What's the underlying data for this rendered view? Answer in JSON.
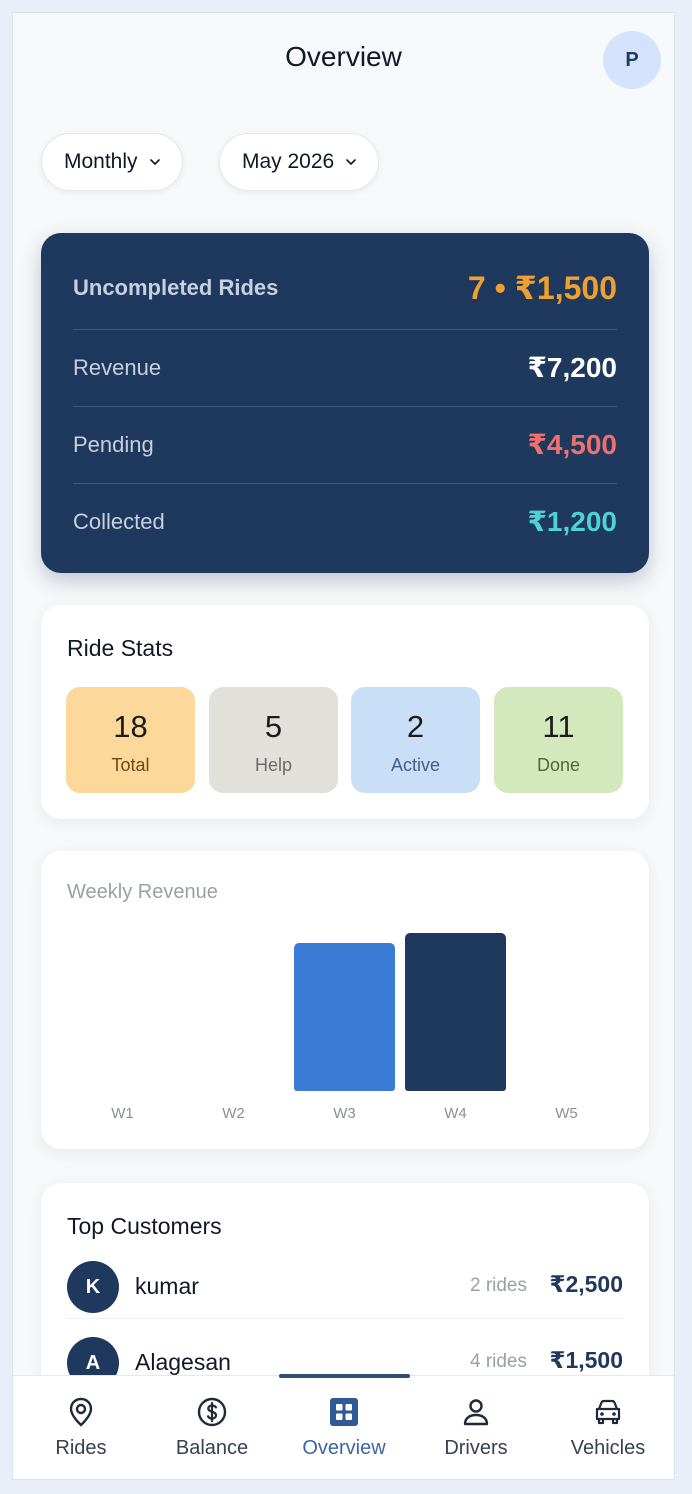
{
  "header": {
    "title": "Overview",
    "avatar_initial": "P"
  },
  "filters": {
    "period": "Monthly",
    "month": "May 2026"
  },
  "summary": {
    "uncompleted": {
      "label": "Uncompleted Rides",
      "value": "7 • ₹1,500",
      "color": "#f0a030"
    },
    "rows": [
      {
        "label": "Revenue",
        "value": "₹7,200",
        "color": "#ffffff"
      },
      {
        "label": "Pending",
        "value": "₹4,500",
        "color": "#f07070"
      },
      {
        "label": "Collected",
        "value": "₹1,200",
        "color": "#4fd2d2"
      }
    ]
  },
  "ride_stats": {
    "title": "Ride Stats",
    "items": [
      {
        "value": "18",
        "label": "Total",
        "bg": "#fcd89a",
        "fg": "#6b4a1a"
      },
      {
        "value": "5",
        "label": "Help",
        "bg": "#e1e0da",
        "fg": "#6b6b6b"
      },
      {
        "value": "2",
        "label": "Active",
        "bg": "#c9def7",
        "fg": "#3e5f8a"
      },
      {
        "value": "11",
        "label": "Done",
        "bg": "#d3e9bd",
        "fg": "#4a6a36"
      }
    ]
  },
  "chart_data": {
    "type": "bar",
    "title": "Weekly Revenue",
    "categories": [
      "W1",
      "W2",
      "W3",
      "W4",
      "W5"
    ],
    "values": [
      0,
      0,
      3000,
      3200,
      0
    ],
    "bar_colors": [
      "#3a7bd5",
      "#3a7bd5",
      "#3a7bd5",
      "#1f385d",
      "#3a7bd5"
    ],
    "ylim": [
      0,
      3200
    ]
  },
  "top_customers": {
    "title": "Top Customers",
    "items": [
      {
        "initial": "K",
        "name": "kumar",
        "rides": "2 rides",
        "amount": "₹2,500"
      },
      {
        "initial": "A",
        "name": "Alagesan",
        "rides": "4 rides",
        "amount": "₹1,500"
      }
    ]
  },
  "nav": {
    "items": [
      {
        "label": "Rides",
        "icon": "location-pin-icon"
      },
      {
        "label": "Balance",
        "icon": "dollar-circle-icon"
      },
      {
        "label": "Overview",
        "icon": "grid-icon",
        "active": true
      },
      {
        "label": "Drivers",
        "icon": "person-icon"
      },
      {
        "label": "Vehicles",
        "icon": "car-icon"
      }
    ]
  }
}
